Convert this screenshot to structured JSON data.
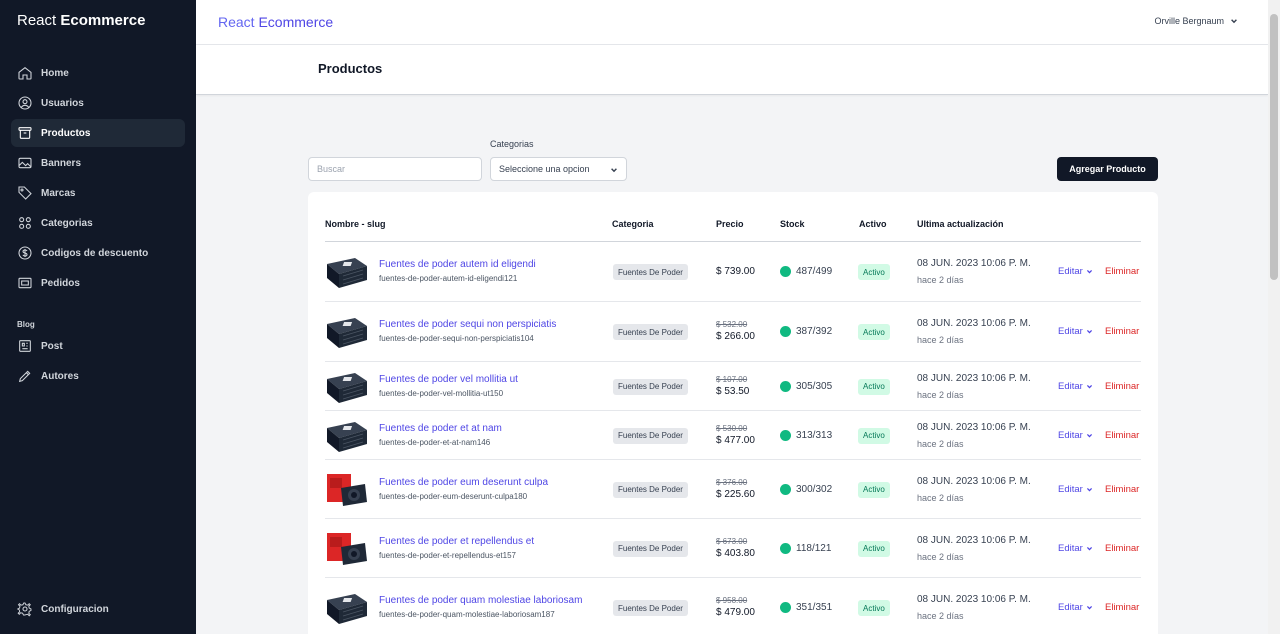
{
  "sidebar": {
    "brand_light": "React",
    "brand_bold": "Ecommerce",
    "items": [
      {
        "label": "Home",
        "icon": "home-icon"
      },
      {
        "label": "Usuarios",
        "icon": "user-circle-icon"
      },
      {
        "label": "Productos",
        "icon": "archive-box-icon",
        "active": true
      },
      {
        "label": "Banners",
        "icon": "photo-icon"
      },
      {
        "label": "Marcas",
        "icon": "tag-icon"
      },
      {
        "label": "Categorias",
        "icon": "squares-icon"
      },
      {
        "label": "Codigos de descuento",
        "icon": "dollar-icon"
      },
      {
        "label": "Pedidos",
        "icon": "receipt-icon"
      }
    ],
    "section_blog": "Blog",
    "blog_items": [
      {
        "label": "Post",
        "icon": "newspaper-icon"
      },
      {
        "label": "Autores",
        "icon": "pencil-icon"
      }
    ],
    "config_label": "Configuracion"
  },
  "topbar": {
    "brand_light": "React",
    "brand_bold": "Ecommerce",
    "user_name": "Orville Bergnaum"
  },
  "page": {
    "title": "Productos"
  },
  "filters": {
    "search_placeholder": "Buscar",
    "category_label": "Categorias",
    "category_value": "Seleccione una opcion",
    "add_button": "Agregar Producto"
  },
  "table": {
    "headers": {
      "name": "Nombre - slug",
      "category": "Categoria",
      "price": "Precio",
      "stock": "Stock",
      "active": "Activo",
      "updated": "Ultima actualización"
    },
    "edit_label": "Editar",
    "delete_label": "Eliminar",
    "rows": [
      {
        "name": "Fuentes de poder autem id eligendi",
        "slug": "fuentes-de-poder-autem-id-eligendi121",
        "category": "Fuentes De Poder",
        "old_price": "",
        "price": "$ 739.00",
        "stock": "487/499",
        "active": "Activo",
        "date": "08 JUN. 2023 10:06 P. M.",
        "ago": "hace 2 días",
        "image": "black-psu"
      },
      {
        "name": "Fuentes de poder sequi non perspiciatis",
        "slug": "fuentes-de-poder-sequi-non-perspiciatis104",
        "category": "Fuentes De Poder",
        "old_price": "$ 532.00",
        "price": "$ 266.00",
        "stock": "387/392",
        "active": "Activo",
        "date": "08 JUN. 2023 10:06 P. M.",
        "ago": "hace 2 días",
        "image": "black-psu"
      },
      {
        "name": "Fuentes de poder vel mollitia ut",
        "slug": "fuentes-de-poder-vel-mollitia-ut150",
        "category": "Fuentes De Poder",
        "old_price": "$ 107.00",
        "price": "$ 53.50",
        "stock": "305/305",
        "active": "Activo",
        "date": "08 JUN. 2023 10:06 P. M.",
        "ago": "hace 2 días",
        "image": "black-psu"
      },
      {
        "name": "Fuentes de poder et at nam",
        "slug": "fuentes-de-poder-et-at-nam146",
        "category": "Fuentes De Poder",
        "old_price": "$ 530.00",
        "price": "$ 477.00",
        "stock": "313/313",
        "active": "Activo",
        "date": "08 JUN. 2023 10:06 P. M.",
        "ago": "hace 2 días",
        "image": "black-psu"
      },
      {
        "name": "Fuentes de poder eum deserunt culpa",
        "slug": "fuentes-de-poder-eum-deserunt-culpa180",
        "category": "Fuentes De Poder",
        "old_price": "$ 376.00",
        "price": "$ 225.60",
        "stock": "300/302",
        "active": "Activo",
        "date": "08 JUN. 2023 10:06 P. M.",
        "ago": "hace 2 días",
        "image": "red-box-psu"
      },
      {
        "name": "Fuentes de poder et repellendus et",
        "slug": "fuentes-de-poder-et-repellendus-et157",
        "category": "Fuentes De Poder",
        "old_price": "$ 673.00",
        "price": "$ 403.80",
        "stock": "118/121",
        "active": "Activo",
        "date": "08 JUN. 2023 10:06 P. M.",
        "ago": "hace 2 días",
        "image": "red-box-psu"
      },
      {
        "name": "Fuentes de poder quam molestiae laboriosam",
        "slug": "fuentes-de-poder-quam-molestiae-laboriosam187",
        "category": "Fuentes De Poder",
        "old_price": "$ 958.00",
        "price": "$ 479.00",
        "stock": "351/351",
        "active": "Activo",
        "date": "08 JUN. 2023 10:06 P. M.",
        "ago": "hace 2 días",
        "image": "black-psu"
      }
    ]
  },
  "colors": {
    "sidebar_bg": "#111827",
    "accent": "#4f46e5",
    "danger": "#dc2626",
    "success": "#10b981"
  }
}
